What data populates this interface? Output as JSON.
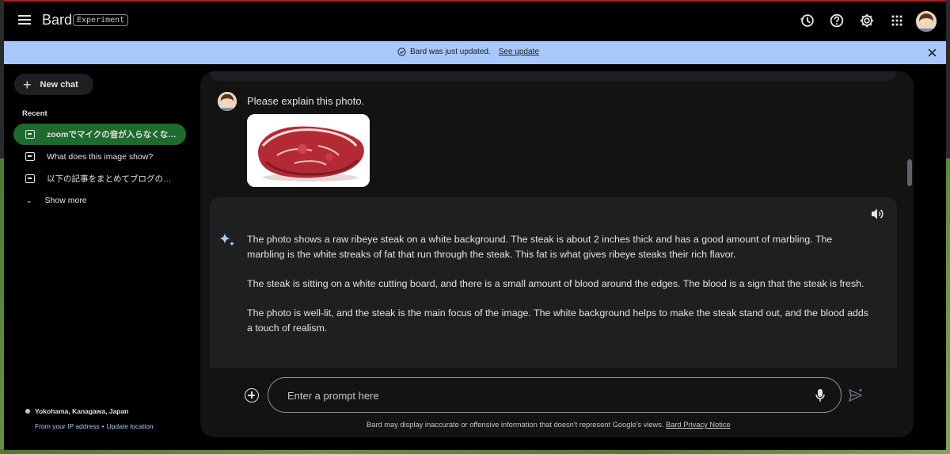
{
  "header": {
    "title": "Bard",
    "badge": "Experiment",
    "icons": [
      "menu-icon",
      "history-icon",
      "help-icon",
      "settings-icon",
      "apps-icon",
      "avatar"
    ]
  },
  "banner": {
    "message": "Bard was just updated.",
    "link": "See update",
    "color": "#a8c7fa"
  },
  "sidebar": {
    "new_chat_label": "New chat",
    "recent_title": "Recent",
    "items": [
      {
        "label": "zoomでマイクの音が入らなくな…",
        "active": true
      },
      {
        "label": "What does this image show?",
        "active": false
      },
      {
        "label": "以下の記事をまとめてブログの…",
        "active": false
      }
    ],
    "show_more_label": "Show more",
    "location": "Yokohama, Kanagawa, Japan",
    "location_source": "From your IP address",
    "location_separator": "•",
    "update_location": "Update location"
  },
  "conversation": {
    "user_message": "Please explain this photo.",
    "response_paragraphs": [
      "The photo shows a raw ribeye steak on a white background. The steak is about 2 inches thick and has a good amount of marbling. The marbling is the white streaks of fat that run through the steak. This fat is what gives ribeye steaks their rich flavor.",
      "The steak is sitting on a white cutting board, and there is a small amount of blood around the edges. The blood is a sign that the steak is fresh.",
      "The photo is well-lit, and the steak is the main focus of the image. The white background helps to make the steak stand out, and the blood adds a touch of realism."
    ]
  },
  "input": {
    "placeholder": "Enter a prompt here"
  },
  "footer": {
    "disclaimer": "Bard may display inaccurate or offensive information that doesn't represent Google's views.",
    "privacy_link": "Bard Privacy Notice"
  },
  "colors": {
    "accent": "#a8c7fa",
    "active_item": "#1e6b2e",
    "background": "#000000",
    "panel": "#131314",
    "card": "#1e1f20"
  }
}
